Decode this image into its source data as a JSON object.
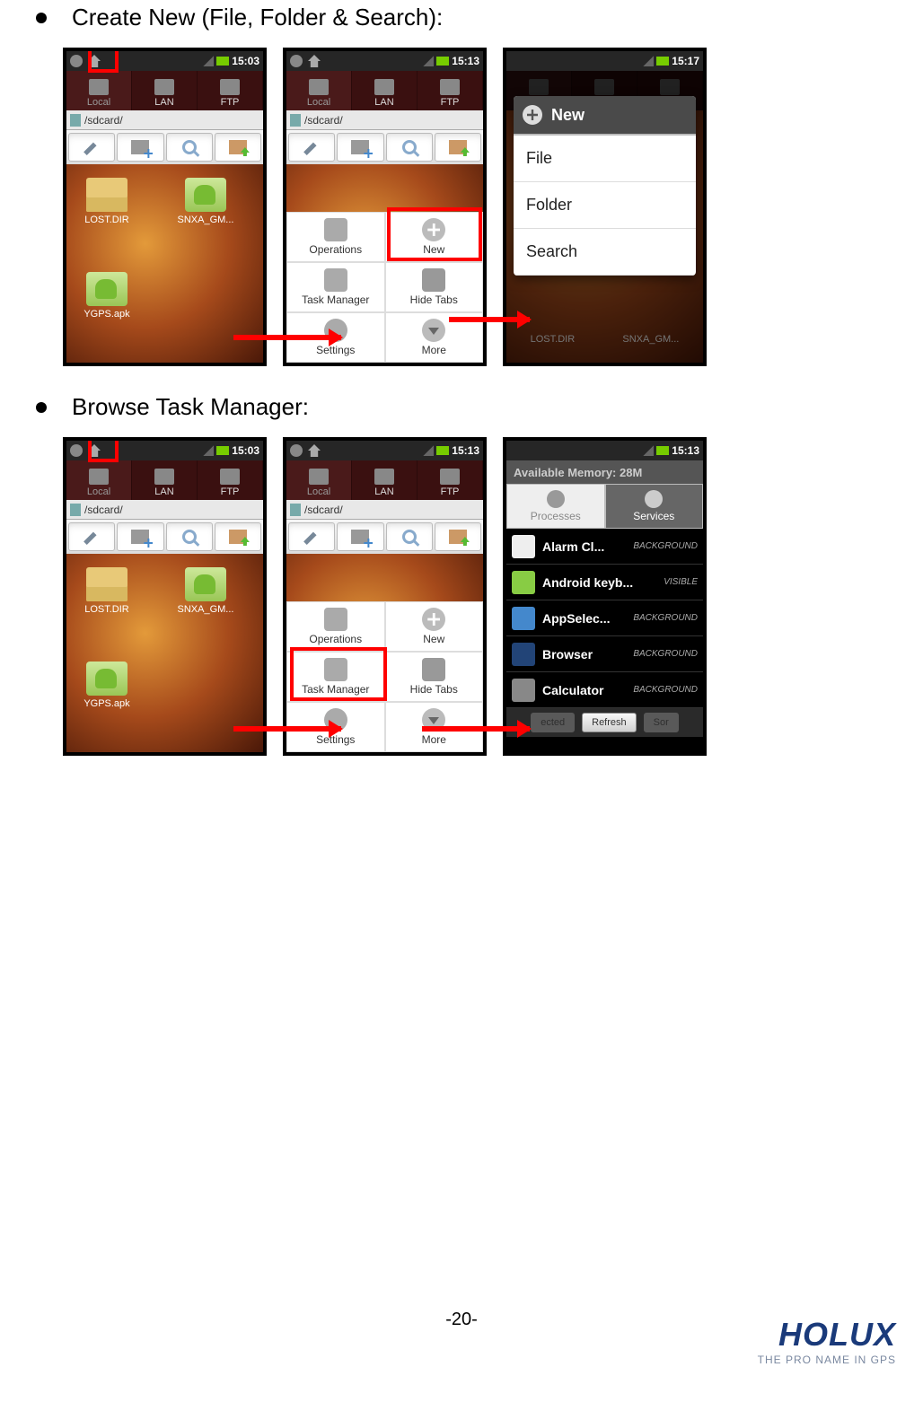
{
  "section1": {
    "title": "Create New (File, Folder & Search):"
  },
  "section2": {
    "title": "Browse Task Manager:"
  },
  "status": {
    "t1503": "15:03",
    "t1513": "15:13",
    "t1517": "15:17"
  },
  "tabs": {
    "local": "Local",
    "lan": "LAN",
    "ftp": "FTP"
  },
  "path": "/sdcard/",
  "files": {
    "lostdir": "LOST.DIR",
    "snxa": "SNXA_GM...",
    "ygps": "YGPS.apk"
  },
  "menu": {
    "operations": "Operations",
    "new": "New",
    "taskmgr": "Task Manager",
    "hidetabs": "Hide Tabs",
    "settings": "Settings",
    "more": "More"
  },
  "newDialog": {
    "title": "New",
    "file": "File",
    "folder": "Folder",
    "search": "Search"
  },
  "taskmgr": {
    "memory": "Available Memory: 28M",
    "processes": "Processes",
    "services": "Services",
    "rows": [
      {
        "name": "Alarm Cl...",
        "status": "BACKGROUND"
      },
      {
        "name": "Android keyb...",
        "status": "VISIBLE"
      },
      {
        "name": "AppSelec...",
        "status": "BACKGROUND"
      },
      {
        "name": "Browser",
        "status": "BACKGROUND"
      },
      {
        "name": "Calculator",
        "status": "BACKGROUND"
      }
    ],
    "footer": {
      "selected": "ected",
      "refresh": "Refresh",
      "sort": "Sor"
    }
  },
  "pageNum": "-20-",
  "logo": {
    "brand": "HOLUX",
    "tag": "THE PRO NAME IN GPS"
  }
}
